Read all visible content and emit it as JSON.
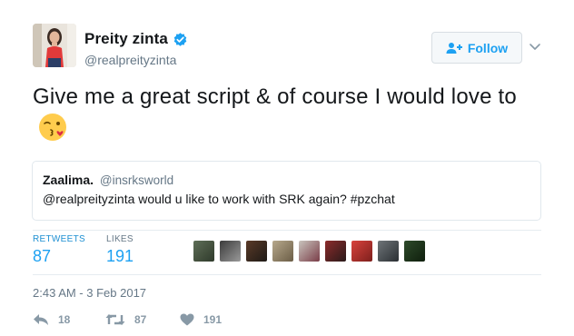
{
  "author": {
    "display_name": "Preity zinta",
    "handle": "@realpreityzinta",
    "verified": true,
    "avatar_icon": "profile-photo"
  },
  "follow_button": {
    "label": "Follow",
    "icon": "add-user-icon"
  },
  "tweet": {
    "text": "Give me a great script & of course I would love to",
    "emoji": "face-throwing-kiss-emoji"
  },
  "quoted_tweet": {
    "name": "Zaalima.",
    "handle": "@insrksworld",
    "text": "@realpreityzinta would u like to work with SRK again? #pzchat"
  },
  "stats": {
    "retweets_label": "RETWEETS",
    "retweets_value": "87",
    "likes_label": "LIKES",
    "likes_value": "191"
  },
  "likers_count_shown": 9,
  "timestamp": "2:43 AM - 3 Feb 2017",
  "actions": {
    "reply_count": "18",
    "retweet_count": "87",
    "like_count": "191"
  },
  "colors": {
    "accent": "#1da1f2",
    "secondary_text": "#657786",
    "action_gray": "#8899a6",
    "border": "#e1e8ed"
  }
}
